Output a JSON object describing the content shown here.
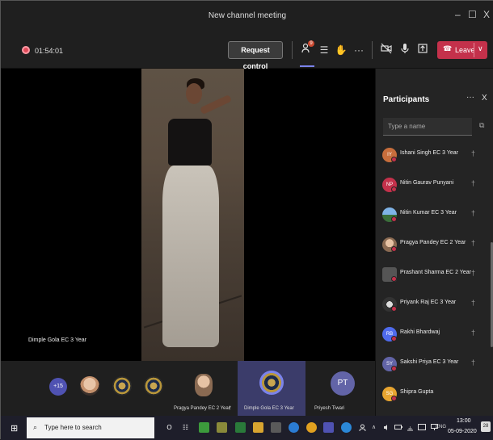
{
  "window": {
    "title": "New channel meeting",
    "minimize": "–",
    "restore": "☐",
    "close": "X"
  },
  "toolbar": {
    "timer": "01:54:01",
    "request_control": "Request control",
    "participants_icon": "participants-icon",
    "participants_badge": "9",
    "chat_icon": "☰",
    "raise_hand_icon": "✋",
    "more": "···",
    "camera_icon": "✕",
    "mic_icon": "↓",
    "share_icon": "↑",
    "leave_label": "Leave",
    "leave_icon": "☎",
    "leave_chevron": "∨",
    "accent": "#7b83eb",
    "leave_color": "#c4314b"
  },
  "stage": {
    "speaker_name": "Dimple Gola EC 3 Year"
  },
  "strip": {
    "more_count": "+15",
    "tiles": [
      {
        "name": "Pragya Pandey EC 2 Year",
        "mic_icon": "†"
      },
      {
        "name": "Dimple Gola EC 3 Year"
      },
      {
        "name": "Priyesh Tiwari",
        "initials": "PT"
      }
    ]
  },
  "panel": {
    "title": "Participants",
    "more": "···",
    "close": "X",
    "search_placeholder": "Type a name",
    "share_icon": "⧉",
    "participants": [
      {
        "name": "Ishani Singh EC 3 Year",
        "initials": "IY",
        "color": "#c76e3c"
      },
      {
        "name": "Nitin Gaurav Punyani",
        "initials": "NP",
        "color": "#c4314b"
      },
      {
        "name": "Nitin Kumar EC 3 Year",
        "initials": "",
        "color": "#4a90c8"
      },
      {
        "name": "Pragya Pandey EC 2 Year",
        "initials": "",
        "color": "#b3835a"
      },
      {
        "name": "Prashant Sharma EC 2 Year",
        "initials": "",
        "color": "#666666"
      },
      {
        "name": "Priyank Raj EC 3 Year",
        "initials": "",
        "color": "#3a3a3a"
      },
      {
        "name": "Rakhi Bhardwaj",
        "initials": "RB",
        "color": "#4f6bed"
      },
      {
        "name": "Sakshi Priya EC 3 Year",
        "initials": "SY",
        "color": "#6264a7"
      },
      {
        "name": "Shipra Gupta",
        "initials": "SG",
        "color": "#e8a530"
      }
    ],
    "muted_icon": "†"
  },
  "taskbar": {
    "start_icon": "⊞",
    "search_icon": "⌕",
    "search_text": "Type here to search",
    "cortana_icon": "O",
    "taskview_icon": "☷",
    "lang": "ENG",
    "time": "13:00",
    "date": "05-09-2020",
    "notifications": "28",
    "tray_up": "∧"
  }
}
